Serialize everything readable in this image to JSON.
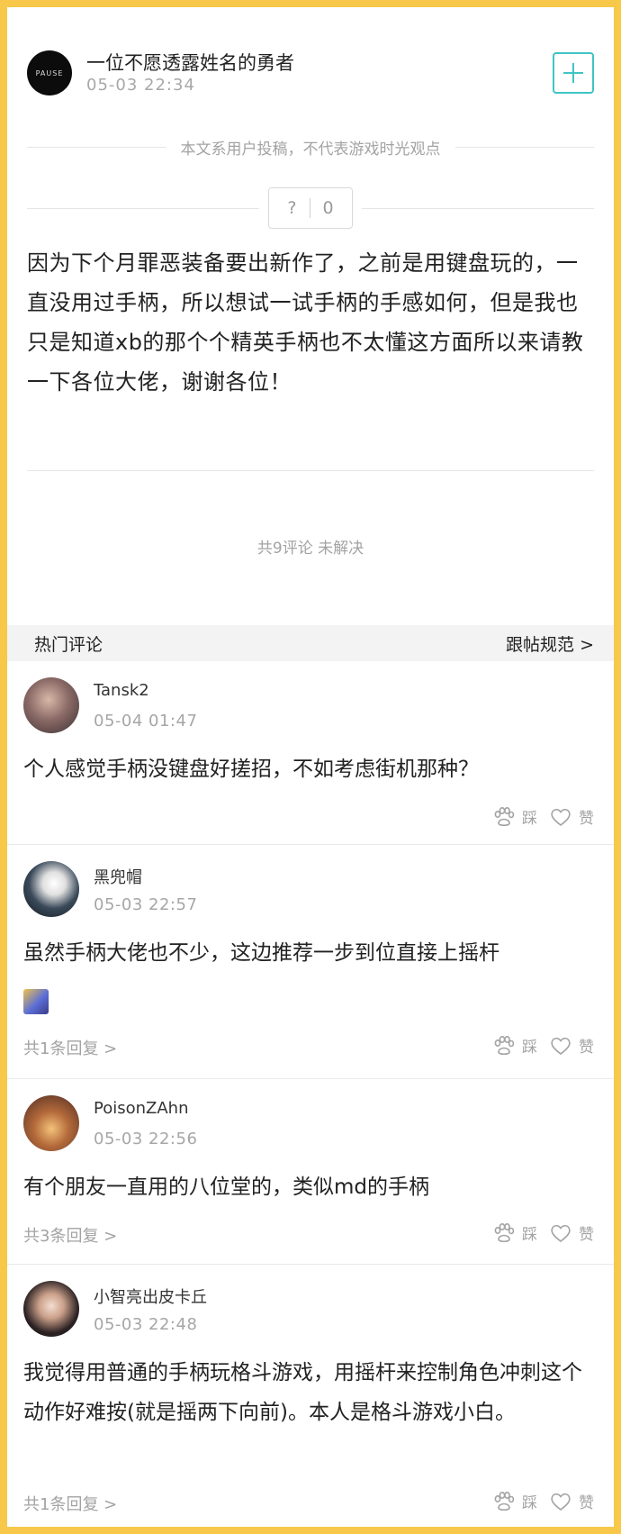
{
  "post": {
    "author": "一位不愿透露姓名的勇者",
    "time": "05-03 22:34",
    "avatar_text": "PAUSE",
    "follow_icon": "plus-icon",
    "disclaimer": "本文系用户投稿，不代表游戏时光观点",
    "vote_question": "?",
    "vote_count": "0",
    "body": "因为下个月罪恶装备要出新作了，之前是用键盘玩的，一直没用过手柄，所以想试一试手柄的手感如何，但是我也只是知道xb的那个个精英手柄也不太懂这方面所以来请教一下各位大佬，谢谢各位！",
    "summary": "共9评论  未解决"
  },
  "hot": {
    "title": "热门评论",
    "rules": "跟帖规范 >"
  },
  "actions": {
    "tread": "踩",
    "like": "赞"
  },
  "colors": {
    "accent": "#40c4c4",
    "frame": "#f7c84a"
  },
  "comments": [
    {
      "name": "Tansk2",
      "time": "05-04 01:47",
      "text": "个人感觉手柄没键盘好搓招，不如考虑街机那种？",
      "replies": ""
    },
    {
      "name": "黑兜帽",
      "time": "05-03 22:57",
      "text": "虽然手柄大佬也不少，这边推荐一步到位直接上摇杆",
      "replies": "共1条回复 >"
    },
    {
      "name": "PoisonZAhn",
      "time": "05-03 22:56",
      "text": "有个朋友一直用的八位堂的，类似md的手柄",
      "replies": "共3条回复 >"
    },
    {
      "name": "小智亮出皮卡丘",
      "time": "05-03 22:48",
      "text": "我觉得用普通的手柄玩格斗游戏，用摇杆来控制角色冲刺这个动作好难按(就是摇两下向前)。本人是格斗游戏小白。",
      "replies": "共1条回复 >"
    }
  ]
}
